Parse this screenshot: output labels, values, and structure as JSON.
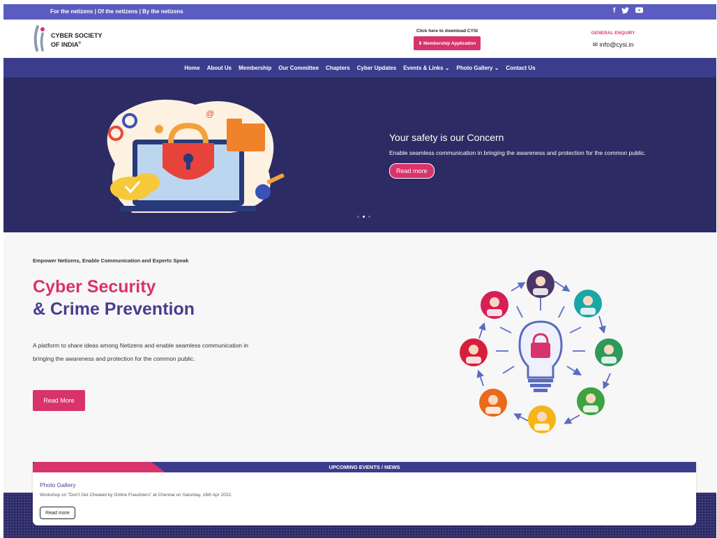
{
  "topbar": {
    "tagline": "For the netizens | Of the netizens | By the netizens",
    "social": [
      {
        "icon": "facebook-icon",
        "glyph": "f"
      },
      {
        "icon": "twitter-icon",
        "glyph": "🐦"
      },
      {
        "icon": "youtube-icon",
        "glyph": "▶"
      }
    ]
  },
  "header": {
    "logo_line1": "CYBER SOCIETY",
    "logo_line2": "OF INDIA",
    "logo_mark": "®",
    "download_hint": "Click here to download CYSI",
    "membership_button": "⬇ Membership Application",
    "enquiry_label": "GENERAL ENQUIRY",
    "enquiry_email": "✉ info@cysi.in"
  },
  "nav": {
    "items": [
      "Home",
      "About Us",
      "Membership",
      "Our Committee",
      "Chapters",
      "Cyber Updates",
      "Events & Links ⌄",
      "Photo Gallery ⌄",
      "Contact Us"
    ]
  },
  "hero": {
    "heading": "Your safety is our Concern",
    "text": "Enable seamless communication in bringing the awareness and protection for the common public.",
    "button": "Read more",
    "slide_count": 3,
    "active_slide": 2
  },
  "feature": {
    "kicker": "Empower Netizens, Enable Communication and Experts Speak",
    "title_line1": "Cyber Security",
    "title_line2": "& Crime Prevention",
    "description": "A platform to share ideas among Netizens and enable seamless communication in bringing the awareness and protection for the common public.",
    "button": "Read More"
  },
  "news": {
    "header": "UPCOMING EVENTS / NEWS",
    "item_title": "Photo Gallery",
    "item_desc": "Workshop on \"Don't Get Cheated by Online Fraudsters\" at Chennai on Saturday, 16th Apr 2022.",
    "button": "Read more"
  },
  "colors": {
    "topbar": "#5a5cbf",
    "nav": "#3b3d8c",
    "hero_bg": "#2d2b63",
    "accent": "#d8336c",
    "purple_text": "#4a3d8f"
  }
}
